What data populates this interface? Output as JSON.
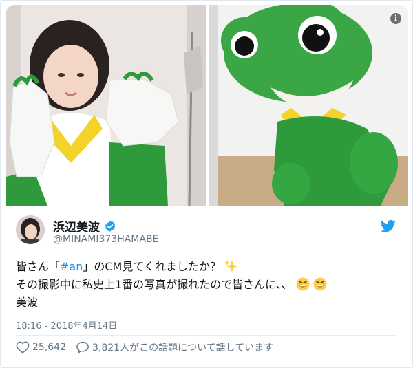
{
  "tweet": {
    "author": {
      "display_name": "浜辺美波",
      "handle": "@MINAMI373HAMABE",
      "verified": true,
      "avatar_icon": "avatar"
    },
    "text": {
      "line1_before": "皆さん「",
      "hashtag": "#an",
      "line1_after": "」のCM見てくれましたか？",
      "line1_emoji": "sparkles-emoji",
      "line2": "その撮影中に私史上1番の写真が撮れたので皆さんに、、",
      "line2_emoji": "grinning-squinting-face-emoji",
      "line3": "美波"
    },
    "timestamp": "18:16 - 2018年4月14日",
    "likes": "25,642",
    "replies_text": "3,821人がこの話題について話しています"
  },
  "icons": {
    "info": "info-icon",
    "brand": "twitter-bird-icon",
    "like": "heart-icon",
    "reply": "reply-icon",
    "verified": "verified-badge-icon"
  },
  "colors": {
    "hashtag": "#1b95e0",
    "twitter_blue": "#1da1f2",
    "muted_text": "#657786",
    "frog_green": "#2e9a3c",
    "collar_yellow": "#f3d22a"
  }
}
